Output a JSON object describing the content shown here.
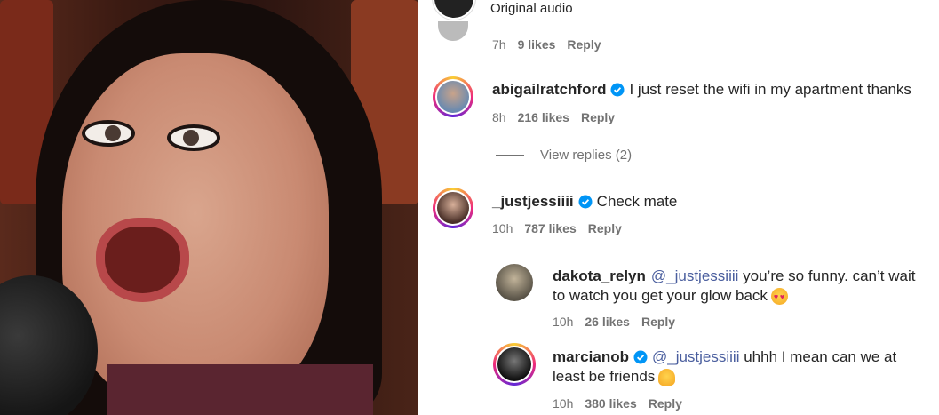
{
  "header": {
    "original_audio": "Original audio"
  },
  "comments": [
    {
      "time": "7h",
      "likes": "9 likes",
      "reply": "Reply"
    },
    {
      "username": "abigailratchford",
      "verified": true,
      "text": "I just reset the wifi in my apartment thanks",
      "time": "8h",
      "likes": "216 likes",
      "reply": "Reply",
      "view_replies": "View replies (2)"
    },
    {
      "username": "_justjessiiii",
      "verified": true,
      "text": "Check mate",
      "time": "10h",
      "likes": "787 likes",
      "reply": "Reply"
    }
  ],
  "replies": [
    {
      "username": "dakota_relyn",
      "mention": "@_justjessiiii",
      "text_line1": " you’re so funny. can’t wait",
      "text_line2": "to watch you get your glow back",
      "emoji": "heart-eyes-emoji",
      "time": "10h",
      "likes": "26 likes",
      "reply": "Reply"
    },
    {
      "username": "marcianob",
      "verified": true,
      "mention": "@_justjessiiii",
      "text_line1": " uhhh I mean can we at",
      "text_line2": "least be friends",
      "emoji": "shrug-emoji",
      "time": "10h",
      "likes": "380 likes",
      "reply": "Reply"
    }
  ],
  "colors": {
    "mention": "#4a5e9e",
    "verified": "#0095f6",
    "meta": "#737373"
  }
}
